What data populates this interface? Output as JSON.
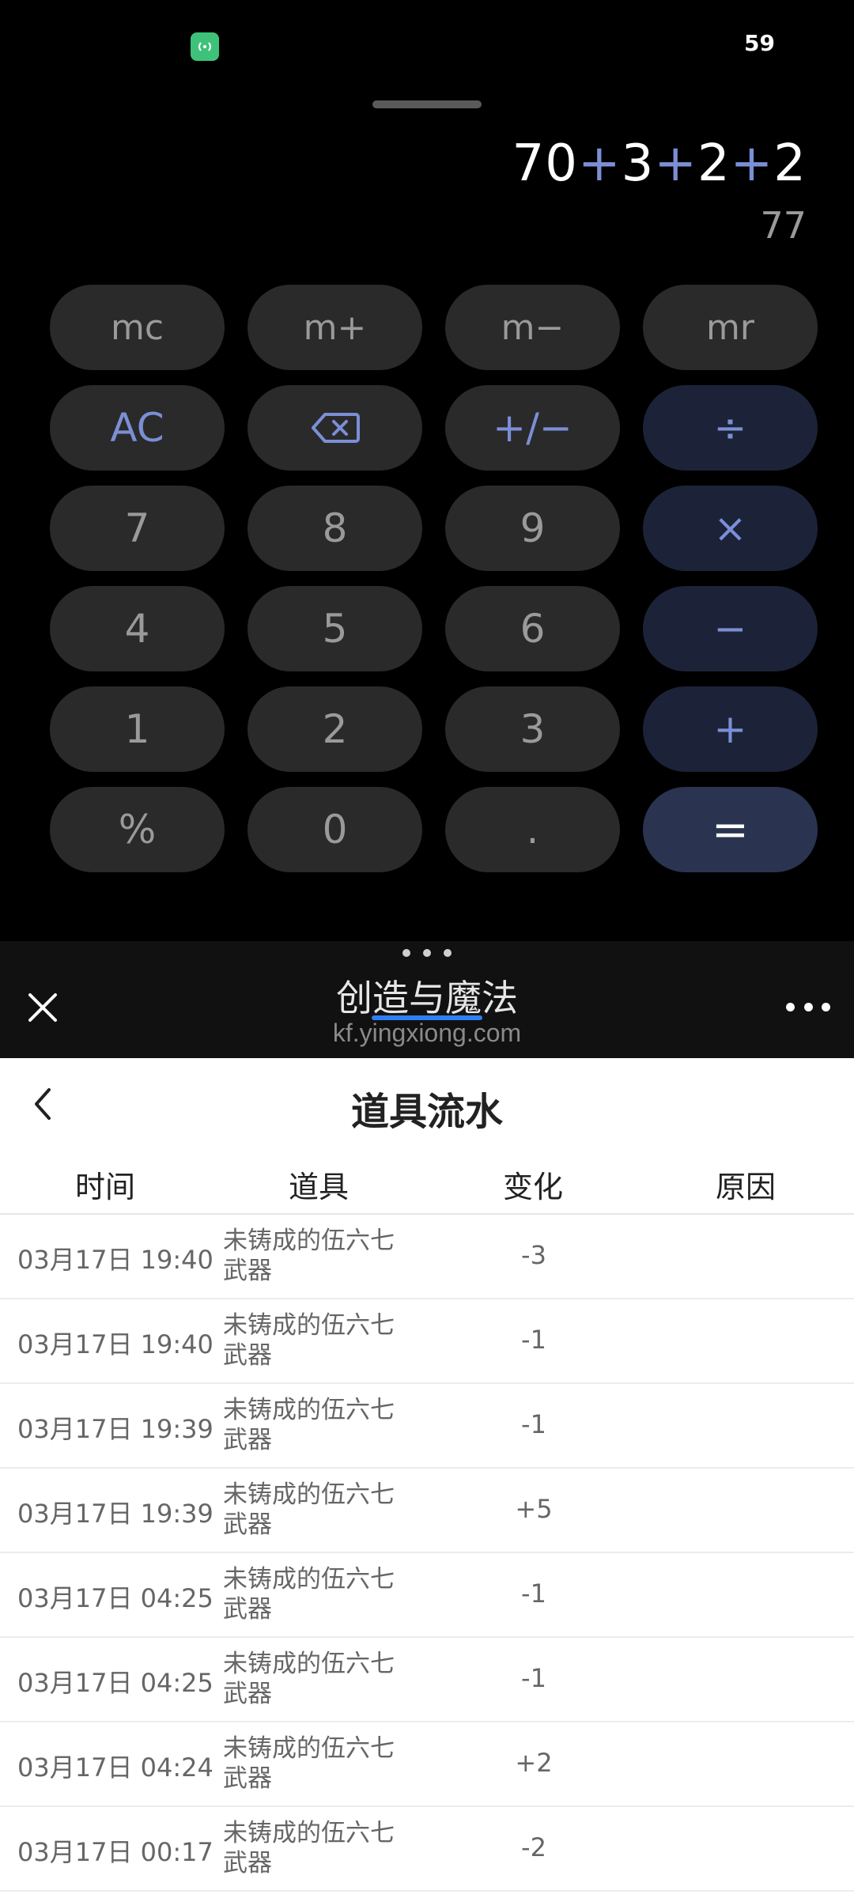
{
  "status_bar": {
    "hotspot_icon": "hotspot-icon",
    "battery": "59"
  },
  "calculator": {
    "expression": [
      "70",
      "+",
      "3",
      "+",
      "2",
      "+",
      "2"
    ],
    "result": "77",
    "keys": [
      {
        "label": "mc",
        "kind": "mem"
      },
      {
        "label": "m+",
        "kind": "mem"
      },
      {
        "label": "m−",
        "kind": "mem"
      },
      {
        "label": "mr",
        "kind": "mem"
      },
      {
        "label": "AC",
        "kind": "fn"
      },
      {
        "label": "⌫",
        "kind": "fn",
        "icon": "backspace-icon"
      },
      {
        "label": "+/−",
        "kind": "fn"
      },
      {
        "label": "÷",
        "kind": "op"
      },
      {
        "label": "7",
        "kind": "num"
      },
      {
        "label": "8",
        "kind": "num"
      },
      {
        "label": "9",
        "kind": "num"
      },
      {
        "label": "×",
        "kind": "op"
      },
      {
        "label": "4",
        "kind": "num"
      },
      {
        "label": "5",
        "kind": "num"
      },
      {
        "label": "6",
        "kind": "num"
      },
      {
        "label": "−",
        "kind": "op"
      },
      {
        "label": "1",
        "kind": "num"
      },
      {
        "label": "2",
        "kind": "num"
      },
      {
        "label": "3",
        "kind": "num"
      },
      {
        "label": "+",
        "kind": "op"
      },
      {
        "label": "%",
        "kind": "num"
      },
      {
        "label": "0",
        "kind": "num"
      },
      {
        "label": ".",
        "kind": "num"
      },
      {
        "label": "=",
        "kind": "eq"
      }
    ]
  },
  "mini_program": {
    "title": "创造与魔法",
    "url": "kf.yingxiong.com",
    "close_icon": "close-icon",
    "more_icon": "more-icon"
  },
  "page": {
    "title": "道具流水",
    "back_icon": "back-icon",
    "columns": [
      "时间",
      "道具",
      "变化",
      "原因"
    ],
    "rows": [
      {
        "time": "03月17日 19:40",
        "item": "未铸成的伍六七武器",
        "change": "-3",
        "reason": ""
      },
      {
        "time": "03月17日 19:40",
        "item": "未铸成的伍六七武器",
        "change": "-1",
        "reason": ""
      },
      {
        "time": "03月17日 19:39",
        "item": "未铸成的伍六七武器",
        "change": "-1",
        "reason": ""
      },
      {
        "time": "03月17日 19:39",
        "item": "未铸成的伍六七武器",
        "change": "+5",
        "reason": ""
      },
      {
        "time": "03月17日 04:25",
        "item": "未铸成的伍六七武器",
        "change": "-1",
        "reason": ""
      },
      {
        "time": "03月17日 04:25",
        "item": "未铸成的伍六七武器",
        "change": "-1",
        "reason": ""
      },
      {
        "time": "03月17日 04:24",
        "item": "未铸成的伍六七武器",
        "change": "+2",
        "reason": ""
      },
      {
        "time": "03月17日 00:17",
        "item": "未铸成的伍六七武器",
        "change": "-2",
        "reason": ""
      }
    ]
  },
  "colors": {
    "accent": "#7b8fd6",
    "op_key_bg": "#1c2338",
    "eq_key_bg": "#2a3450",
    "key_bg": "#2a2a2a",
    "link_underline": "#2f7ff2"
  }
}
